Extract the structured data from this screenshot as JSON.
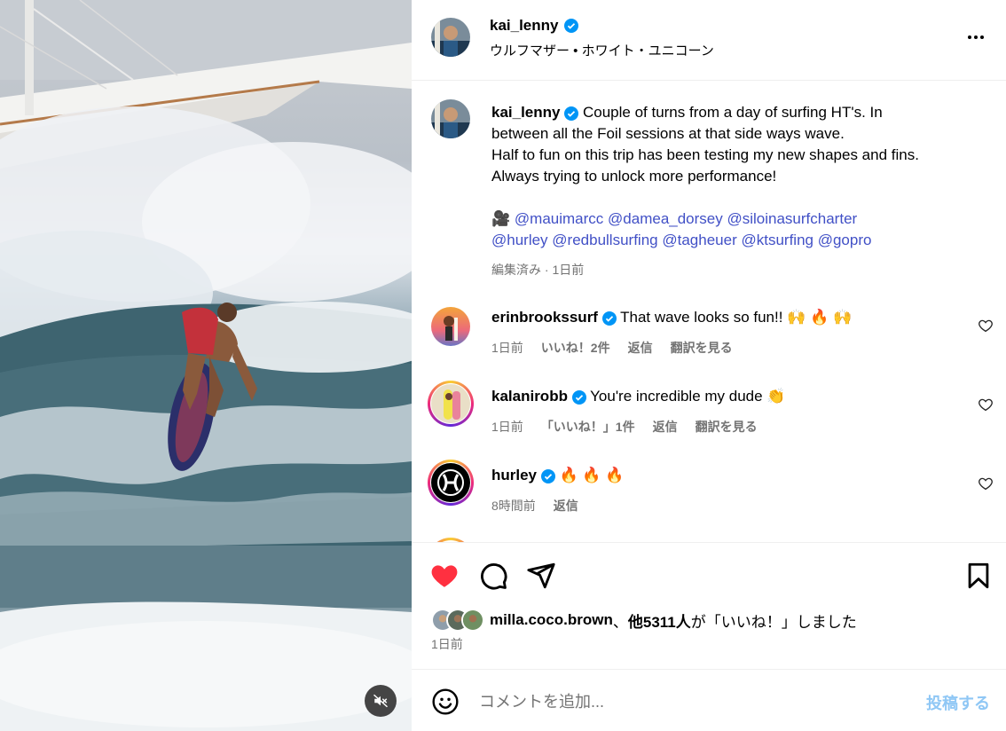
{
  "header": {
    "username": "kai_lenny",
    "audio": "ウルフマザー • ホワイト・ユニコーン",
    "more_icon": "more-horizontal-icon"
  },
  "caption": {
    "username": "kai_lenny",
    "text_lines": [
      "Couple of turns from a day of surfing HT's. In",
      "between all the Foil sessions at that side ways wave.",
      "Half to fun on this trip has been testing my new shapes and fins.",
      "Always trying to unlock more performance!"
    ],
    "camera_emoji": "🎥",
    "mentions": [
      "@mauimarcc",
      "@damea_dorsey",
      "@siloinasurfcharter",
      "@hurley",
      "@redbullsurfing",
      "@tagheuer",
      "@ktsurfing",
      "@gopro"
    ],
    "meta": "編集済み · 1日前"
  },
  "comments": [
    {
      "username": "erinbrookssurf",
      "verified": true,
      "text": "That wave looks so fun!! 🙌 🔥 🙌",
      "time": "1日前",
      "likes": "いいね！2件",
      "reply": "返信",
      "translate": "翻訳を見る"
    },
    {
      "username": "kalanirobb",
      "verified": true,
      "text": "You're incredible my dude 👏",
      "time": "1日前",
      "likes": "「いいね！」1件",
      "reply": "返信",
      "translate": "翻訳を見る"
    },
    {
      "username": "hurley",
      "verified": true,
      "text": "🔥 🔥 🔥",
      "time": "8時間前",
      "reply": "返信"
    }
  ],
  "actions": {
    "liked": true,
    "like_color": "#ff3040",
    "icons": [
      "heart-filled-icon",
      "comment-icon",
      "share-icon",
      "bookmark-icon"
    ]
  },
  "likes": {
    "first_user": "milla.coco.brown",
    "separator": "、",
    "others": "他5311人",
    "suffix": "が「いいね！」しました"
  },
  "post_time": "1日前",
  "comment_box": {
    "placeholder": "コメントを追加...",
    "post_label": "投稿する"
  },
  "colors": {
    "verified": "#0095f6",
    "muted_text": "#737373",
    "mention": "#4150c6"
  }
}
